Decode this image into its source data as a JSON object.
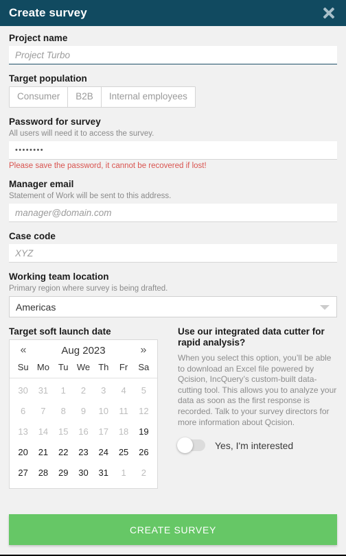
{
  "header": {
    "title": "Create survey",
    "close_icon": "close-icon"
  },
  "form": {
    "project_name": {
      "label": "Project name",
      "placeholder": "Project Turbo",
      "value": ""
    },
    "target_population": {
      "label": "Target population",
      "options": [
        "Consumer",
        "B2B",
        "Internal employees"
      ]
    },
    "password": {
      "label": "Password for survey",
      "hint": "All users will need it to access the survey.",
      "value": "••••••••",
      "error": "Please save the password, it cannot be recovered if lost!"
    },
    "manager_email": {
      "label": "Manager email",
      "hint": "Statement of Work will be sent to this address.",
      "placeholder": "manager@domain.com",
      "value": ""
    },
    "case_code": {
      "label": "Case code",
      "placeholder": "XYZ",
      "value": ""
    },
    "working_team_location": {
      "label": "Working team location",
      "hint": "Primary region where survey is being drafted.",
      "selected": "Americas",
      "arrow_icon": "chevron-down-icon"
    },
    "launch_date": {
      "label": "Target soft launch date",
      "prev_icon": "«",
      "next_icon": "»",
      "month": "Aug 2023",
      "dow": [
        "Su",
        "Mo",
        "Tu",
        "We",
        "Th",
        "Fr",
        "Sa"
      ],
      "weeks": [
        [
          {
            "d": "30",
            "muted": true
          },
          {
            "d": "31",
            "muted": true
          },
          {
            "d": "1",
            "muted": true
          },
          {
            "d": "2",
            "muted": true
          },
          {
            "d": "3",
            "muted": true
          },
          {
            "d": "4",
            "muted": true
          },
          {
            "d": "5",
            "muted": true
          }
        ],
        [
          {
            "d": "6",
            "muted": true
          },
          {
            "d": "7",
            "muted": true
          },
          {
            "d": "8",
            "muted": true
          },
          {
            "d": "9",
            "muted": true
          },
          {
            "d": "10",
            "muted": true
          },
          {
            "d": "11",
            "muted": true
          },
          {
            "d": "12",
            "muted": true
          }
        ],
        [
          {
            "d": "13",
            "muted": true
          },
          {
            "d": "14",
            "muted": true
          },
          {
            "d": "15",
            "muted": true
          },
          {
            "d": "16",
            "muted": true
          },
          {
            "d": "17",
            "muted": true
          },
          {
            "d": "18",
            "muted": true
          },
          {
            "d": "19",
            "muted": false
          }
        ],
        [
          {
            "d": "20",
            "muted": false
          },
          {
            "d": "21",
            "muted": false
          },
          {
            "d": "22",
            "muted": false
          },
          {
            "d": "23",
            "muted": false
          },
          {
            "d": "24",
            "muted": false
          },
          {
            "d": "25",
            "muted": false
          },
          {
            "d": "26",
            "muted": false
          }
        ],
        [
          {
            "d": "27",
            "muted": false
          },
          {
            "d": "28",
            "muted": false
          },
          {
            "d": "29",
            "muted": false
          },
          {
            "d": "30",
            "muted": false
          },
          {
            "d": "31",
            "muted": false
          },
          {
            "d": "1",
            "muted": true
          },
          {
            "d": "2",
            "muted": true
          }
        ]
      ]
    },
    "data_cutter": {
      "title": "Use our integrated data cutter for rapid analysis?",
      "description": "When you select this option, you’ll be able to download an Excel file powered by Qcision, IncQuery’s custom-built data-cutting tool. This allows you to analyze your data as soon as the first response is recorded. Talk to your survey directors for more information about Qcision.",
      "toggle_label": "Yes, I'm interested",
      "toggle_on": false
    }
  },
  "footer": {
    "submit_label": "CREATE SURVEY"
  },
  "colors": {
    "header_bg": "#114a60",
    "submit_bg": "#66c766",
    "error_text": "#d9534f",
    "body_bg": "#f1f1f1"
  }
}
